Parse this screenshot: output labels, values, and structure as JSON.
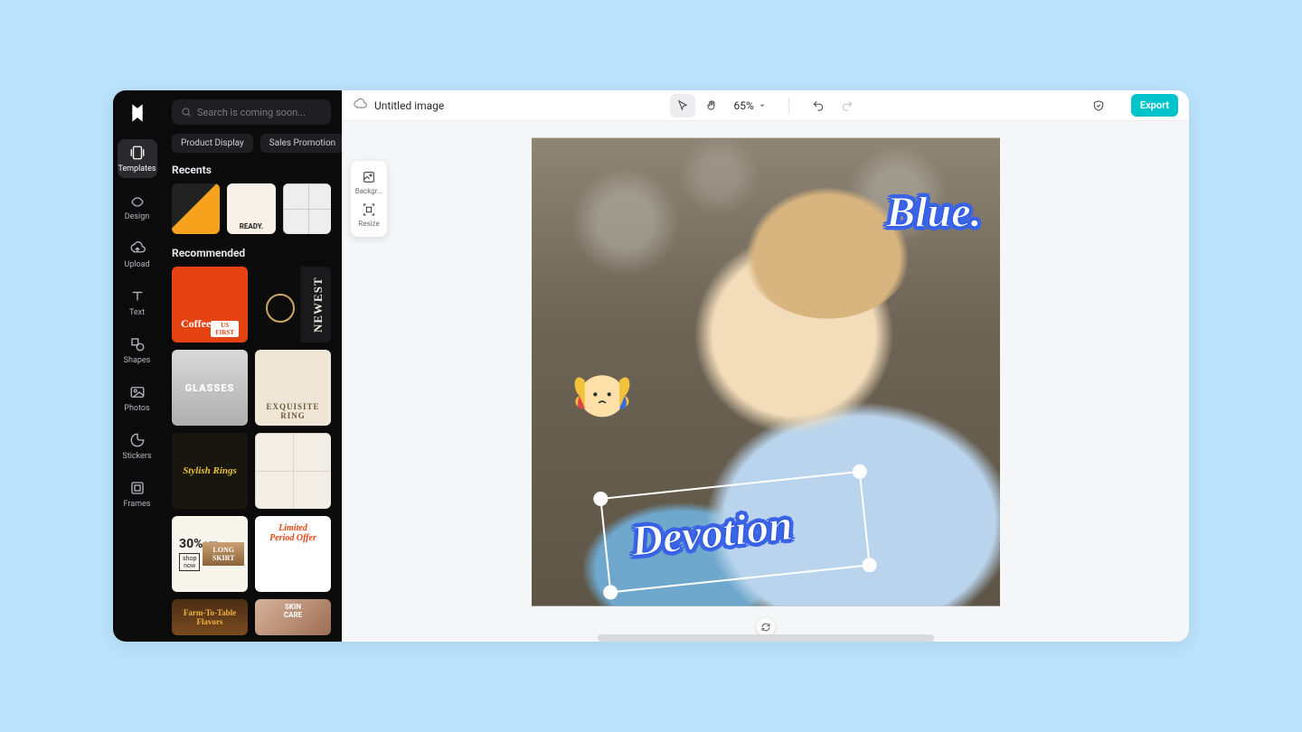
{
  "topbar": {
    "title": "Untitled image",
    "zoom": "65%",
    "export": "Export"
  },
  "float_tools": {
    "background": "Backgr...",
    "resize": "Resize"
  },
  "search": {
    "placeholder": "Search is coming soon..."
  },
  "chips": {
    "product": "Product Display",
    "sales": "Sales Promotion"
  },
  "sections": {
    "recents": "Recents",
    "recommended": "Recommended"
  },
  "rail": {
    "templates": "Templates",
    "design": "Design",
    "upload": "Upload",
    "text": "Text",
    "shapes": "Shapes",
    "photos": "Photos",
    "stickers": "Stickers",
    "frames": "Frames"
  },
  "canvas": {
    "text_blue": "Blue.",
    "text_devotion": "Devotion"
  },
  "thumbs": {
    "r2": "READY.",
    "c1_label": "Coffee",
    "c1_tag": "US FIRST",
    "c2": "NEWEST",
    "c3": "GLASSES",
    "c4": "EXQUISITE RING",
    "c5": "Stylish Rings",
    "c7_pct": "30%",
    "c7_off": "OFF",
    "c7_shop": "shop now",
    "c7_skirt": "LONG SKIRT",
    "c8a": "Limited",
    "c8b": "Period Offer",
    "c9": "Farm-To-Table Flavors",
    "c10a": "SKIN",
    "c10b": "CARE"
  }
}
